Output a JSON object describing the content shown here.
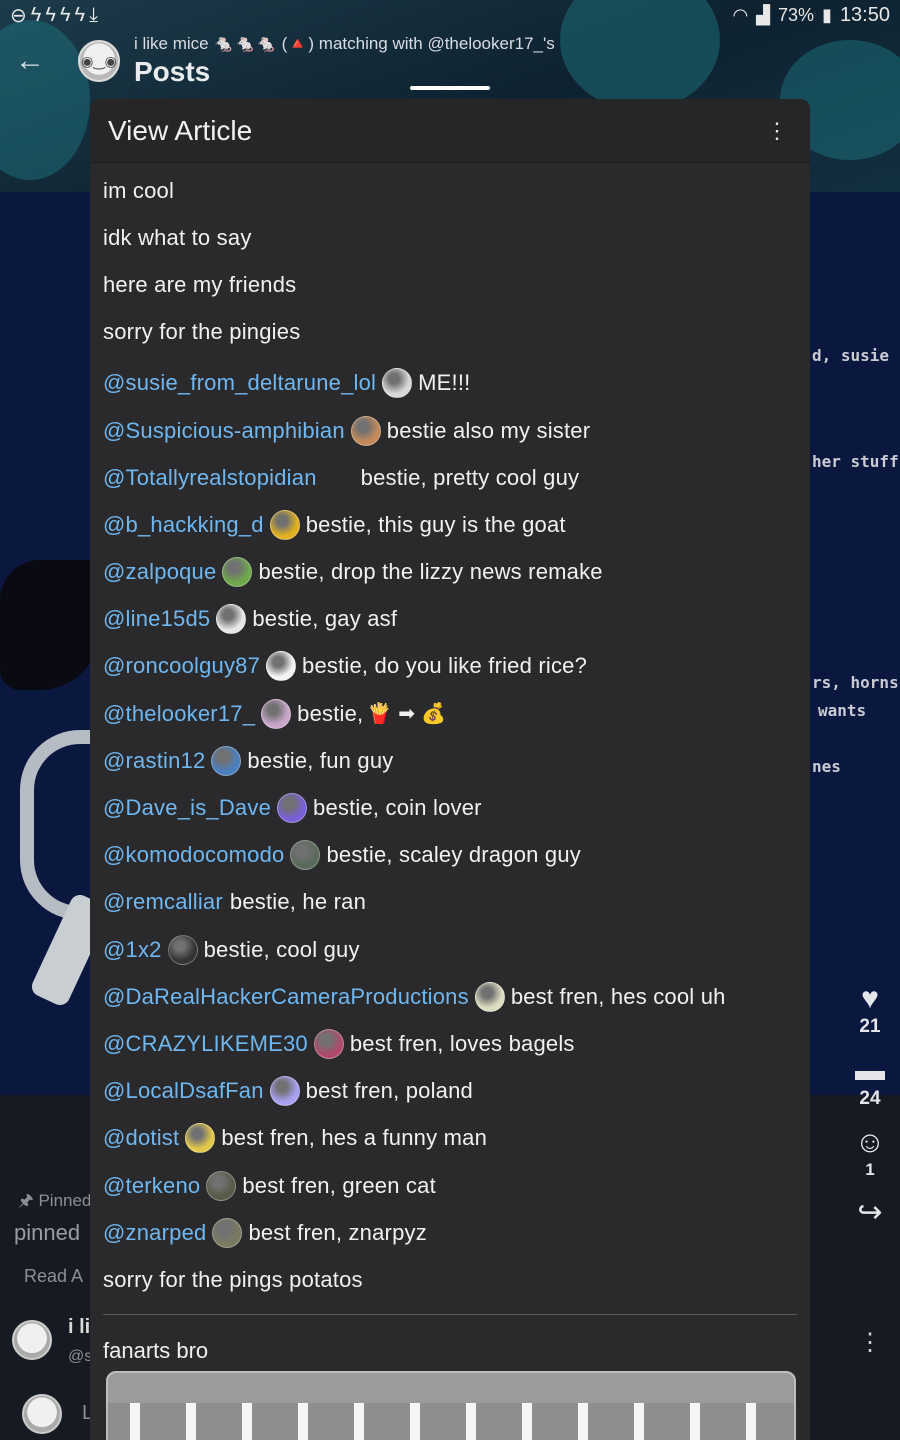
{
  "status_bar": {
    "left_icons": [
      "minus-circle-icon",
      "bolt-icon",
      "bolt-icon",
      "bolt-icon",
      "bolt-icon",
      "download-icon"
    ],
    "battery": "73%",
    "time": "13:50"
  },
  "topbar": {
    "subtitle": "i like mice 🐁🐁🐁 (🔺) matching with @thelooker17_'s",
    "title": "Posts"
  },
  "background": {
    "right_snippets": [
      "d, susie",
      "her stuff",
      "rs, horns,",
      "wants",
      "nes"
    ],
    "left_snippets": [
      "Pinned",
      "pinned",
      "Read A",
      "i li",
      "@s",
      "L"
    ],
    "likes": "21",
    "comments": "24",
    "props": "1"
  },
  "modal": {
    "title": "View Article",
    "menu_icon": "more-vertical-icon",
    "intro": [
      "im cool",
      "idk what to say",
      "here are my friends",
      "sorry for the pingies"
    ],
    "friends": [
      {
        "handle": "@susie_from_deltarune_lol",
        "note": "ME!!!",
        "color": "#d8d8d8"
      },
      {
        "handle": "@Suspicious-amphibian",
        "note": "bestie also my sister",
        "color": "#c48a5a"
      },
      {
        "handle": "@Totallyrealstopidian",
        "note": "bestie, pretty cool guy",
        "color": "none"
      },
      {
        "handle": "@b_hackking_d",
        "note": "bestie, this guy is the goat",
        "color": "#e0b020"
      },
      {
        "handle": "@zalpoque",
        "note": "bestie, drop the lizzy news remake",
        "color": "#6fa84a"
      },
      {
        "handle": "@line15d5",
        "note": "bestie, gay asf",
        "color": "#e6e6e6"
      },
      {
        "handle": "@roncoolguy87",
        "note": "bestie, do you like fried rice?",
        "color": "#f4f4f4"
      },
      {
        "handle": "@thelooker17_",
        "note": "bestie,",
        "color": "#c9a7c9",
        "extra": "🍟 ➡ 💰"
      },
      {
        "handle": "@rastin12",
        "note": "bestie, fun guy",
        "color": "#4a7fc0"
      },
      {
        "handle": "@Dave_is_Dave",
        "note": "bestie, coin lover",
        "color": "#7a5fd8"
      },
      {
        "handle": "@komodocomodo",
        "note": "bestie, scaley dragon guy",
        "color": "#5a6a5a"
      },
      {
        "handle": "@remcalliar",
        "note": "bestie, he ran",
        "color": "none-tight"
      },
      {
        "handle": "@1x2",
        "note": "bestie, cool guy",
        "color": "#333333"
      },
      {
        "handle": "@DaRealHackerCameraProductions",
        "note": "best fren, hes cool uh",
        "color": "#dcdcc0"
      },
      {
        "handle": "@CRAZYLIKEME30",
        "note": "best fren, loves bagels",
        "color": "#b04a6a"
      },
      {
        "handle": "@LocalDsafFan",
        "note": "best fren, poland",
        "color": "#a8a0f0"
      },
      {
        "handle": "@dotist",
        "note": "best fren, hes a funny man",
        "color": "#e2c84a"
      },
      {
        "handle": "@terkeno",
        "note": "best fren, green cat",
        "color": "#5a5a48"
      },
      {
        "handle": "@znarped",
        "note": "best fren, znarpyz",
        "color": "#7a7a62"
      }
    ],
    "outro": "sorry for the pings potatos",
    "section_title": "fanarts bro"
  }
}
